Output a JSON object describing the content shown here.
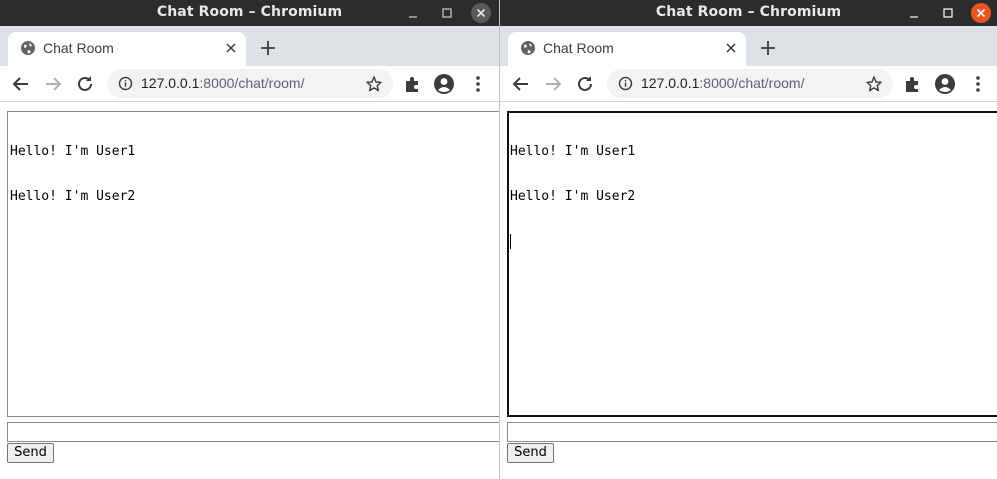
{
  "windows": [
    {
      "id": "left",
      "window_title": "Chat Room – Chromium",
      "tab_title": "Chat Room",
      "url_host": "127.0.0.1",
      "url_rest": ":8000/chat/room/",
      "chat_lines": [
        "Hello! I'm User1",
        "Hello! I'm User2"
      ],
      "message_input_value": "",
      "send_label": "Send",
      "focused": false,
      "close_button_color": "#5a5a5a"
    },
    {
      "id": "right",
      "window_title": "Chat Room – Chromium",
      "tab_title": "Chat Room",
      "url_host": "127.0.0.1",
      "url_rest": ":8000/chat/room/",
      "chat_lines": [
        "Hello! I'm User1",
        "Hello! I'm User2"
      ],
      "message_input_value": "",
      "send_label": "Send",
      "focused": true,
      "close_button_color": "#e9541f"
    }
  ],
  "icons": {
    "minimize": "minimize-icon",
    "maximize": "maximize-icon",
    "close": "close-icon",
    "favicon": "globe-icon",
    "tab_close": "tab-close-icon",
    "new_tab": "plus-icon",
    "back": "back-arrow-icon",
    "forward": "forward-arrow-icon",
    "reload": "reload-icon",
    "site_info": "info-icon",
    "bookmark": "star-icon",
    "extensions": "puzzle-icon",
    "profile": "profile-icon",
    "menu": "kebab-menu-icon"
  },
  "colors": {
    "titlebar_bg": "#2c2c2c",
    "tabstrip_bg": "#dee1e6",
    "omnibox_bg": "#f1f3f4"
  }
}
